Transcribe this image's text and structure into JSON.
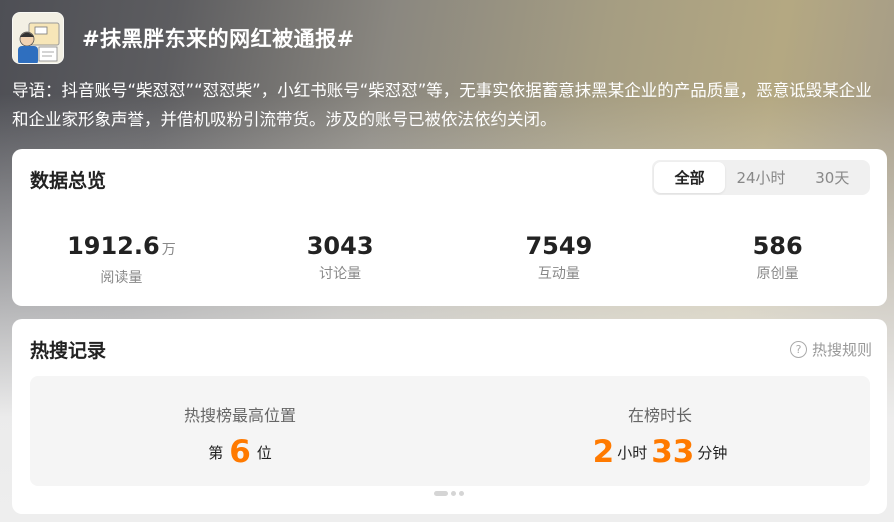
{
  "header": {
    "title": "#抹黑胖东来的网红被通报#"
  },
  "intro": "导语：抖音账号“柴怼怼”“怼怼柴”，小红书账号“柴怼怼”等，无事实依据蓄意抹黑某企业的产品质量，恶意诋毁某企业和企业家形象声誉，并借机吸粉引流带货。涉及的账号已被依法依约关闭。",
  "overview": {
    "title": "数据总览",
    "tabs": [
      "全部",
      "24小时",
      "30天"
    ],
    "active_tab": "全部",
    "stats": [
      {
        "value": "1912.6",
        "unit": "万",
        "label": "阅读量"
      },
      {
        "value": "3043",
        "label": "讨论量"
      },
      {
        "value": "7549",
        "label": "互动量"
      },
      {
        "value": "586",
        "label": "原创量"
      }
    ]
  },
  "hot": {
    "title": "热搜记录",
    "rules_label": "热搜规则",
    "highest": {
      "label": "热搜榜最高位置",
      "prefix": "第",
      "rank": "6",
      "suffix": "位"
    },
    "duration": {
      "label": "在榜时长",
      "hours": "2",
      "hours_unit": "小时",
      "minutes": "33",
      "minutes_unit": "分钟"
    }
  },
  "colors": {
    "accent": "#ff7a00",
    "card_bg": "#ffffff"
  }
}
